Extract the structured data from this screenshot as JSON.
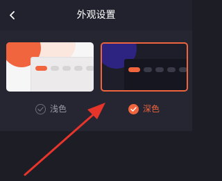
{
  "header": {
    "title": "外观设置",
    "back_icon": "chevron-left-icon"
  },
  "theme_options": [
    {
      "label": "浅色",
      "selected": false
    },
    {
      "label": "深色",
      "selected": true
    }
  ],
  "colors": {
    "accent": "#f0643e",
    "background": "#1d1d26",
    "panel": "#262633",
    "annotation_arrow": "#e8352b"
  }
}
